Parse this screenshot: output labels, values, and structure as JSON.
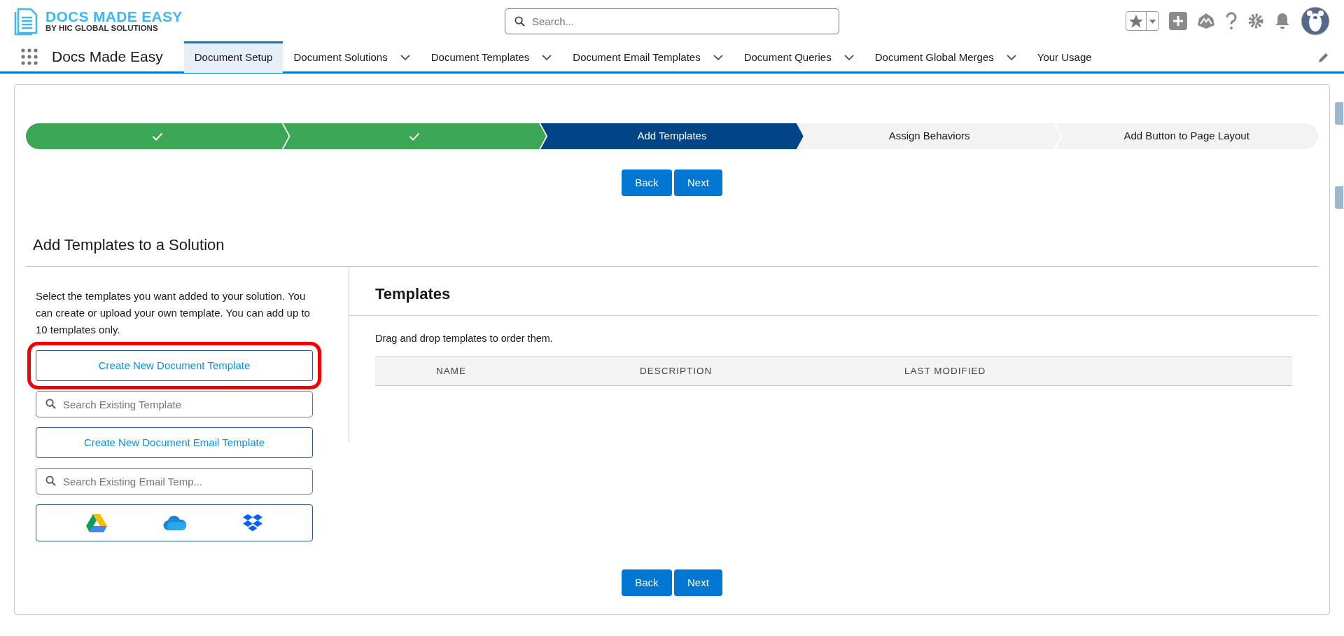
{
  "header": {
    "logo_title": "DOCS MADE EASY",
    "logo_subtitle": "BY HIC GLOBAL SOLUTIONS",
    "search": {
      "placeholder": "Search..."
    }
  },
  "nav": {
    "app_name": "Docs Made Easy",
    "tabs": [
      {
        "label": "Document Setup",
        "selected": true,
        "has_menu": false
      },
      {
        "label": "Document Solutions",
        "selected": false,
        "has_menu": true
      },
      {
        "label": "Document Templates",
        "selected": false,
        "has_menu": true
      },
      {
        "label": "Document Email Templates",
        "selected": false,
        "has_menu": true
      },
      {
        "label": "Document Queries",
        "selected": false,
        "has_menu": true
      },
      {
        "label": "Document Global Merges",
        "selected": false,
        "has_menu": true
      },
      {
        "label": "Your Usage",
        "selected": false,
        "has_menu": false
      }
    ]
  },
  "steps": [
    {
      "completed": true,
      "selected": false
    },
    {
      "completed": true,
      "selected": false
    },
    {
      "label": "Add Templates",
      "completed": false,
      "selected": true
    },
    {
      "label": "Assign Behaviors",
      "completed": false,
      "selected": false
    },
    {
      "label": "Add Button to Page Layout",
      "completed": false,
      "selected": false
    }
  ],
  "top_buttons": [
    "Back",
    "Next"
  ],
  "section_title": "Add Templates to a Solution",
  "left_panel": {
    "instructions": "Select the templates you want added to your solution. You can create or upload your own template. You can add up to 10 templates only.",
    "items": [
      {
        "kind": "button",
        "label": "Create New Document Template",
        "highlighted": true
      },
      {
        "kind": "search",
        "placeholder": "Search Existing Template"
      },
      {
        "kind": "button",
        "label": "Create New Document Email Template",
        "highlighted": false
      },
      {
        "kind": "search",
        "placeholder": "Search Existing Email Temp..."
      },
      {
        "kind": "storage"
      }
    ]
  },
  "templates": {
    "title": "Templates",
    "hint": "Drag and drop templates to order them.",
    "columns": [
      "NAME",
      "DESCRIPTION",
      "LAST MODIFIED"
    ]
  },
  "bottom_buttons": [
    "Back",
    "Next"
  ]
}
